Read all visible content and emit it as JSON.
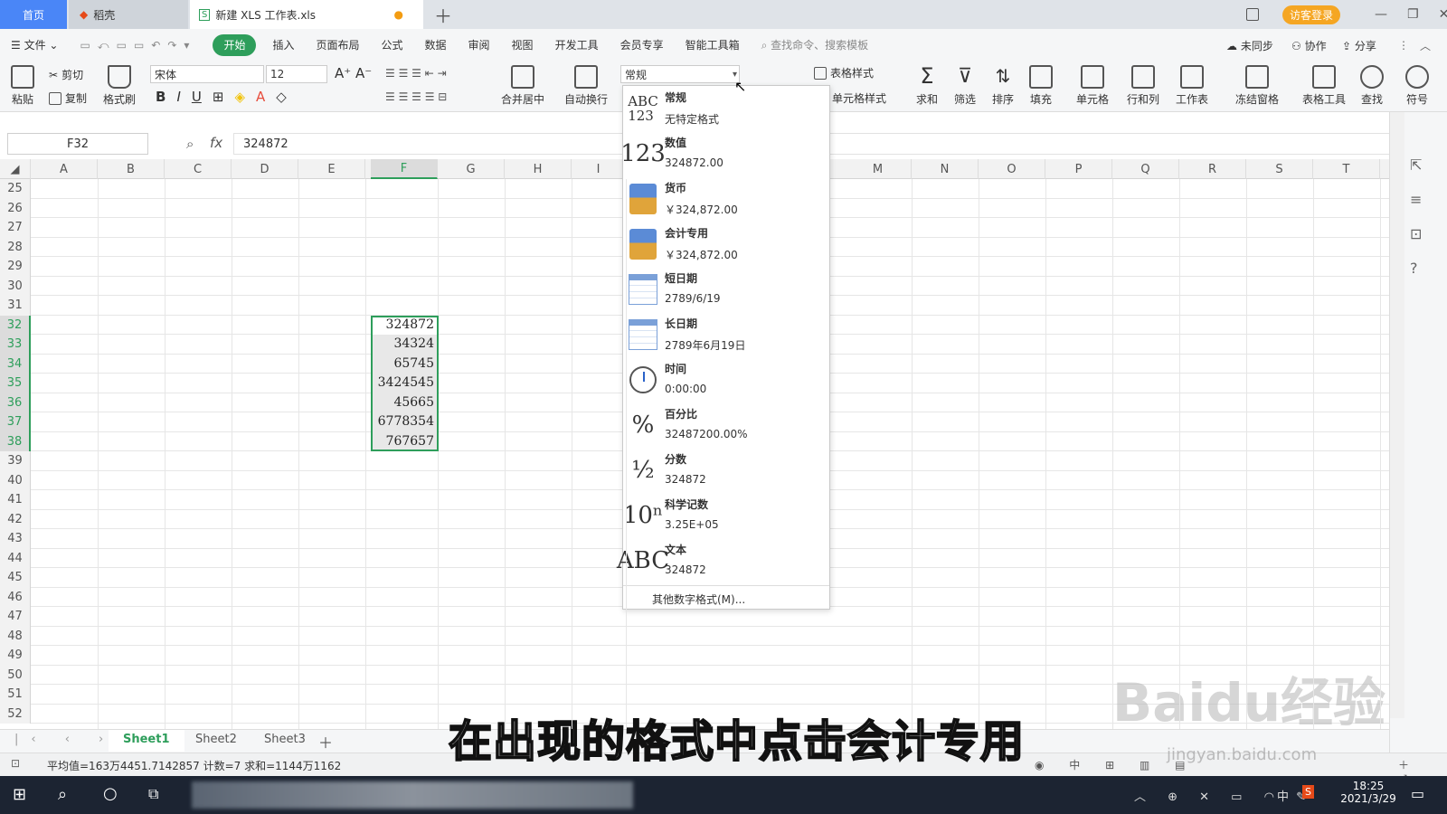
{
  "titlebar": {
    "home": "首页",
    "daoke": "稻壳",
    "doc": "新建 XLS 工作表.xls",
    "login": "访客登录"
  },
  "menu": {
    "file": "文件",
    "items": [
      "开始",
      "插入",
      "页面布局",
      "公式",
      "数据",
      "审阅",
      "视图",
      "开发工具",
      "会员专享",
      "智能工具箱"
    ],
    "search": "查找命令、搜索模板",
    "unsync": "未同步",
    "collab": "协作",
    "share": "分享"
  },
  "ribbon": {
    "paste": "粘贴",
    "cut": "剪切",
    "copy": "复制",
    "format_painter": "格式刷",
    "font": "宋体",
    "size": "12",
    "merge": "合并居中",
    "wrap": "自动换行",
    "numfmt": "常规",
    "table_style": "表格样式",
    "cell_style": "单元格样式",
    "sum": "求和",
    "filter": "筛选",
    "sort": "排序",
    "fill": "填充",
    "cell": "单元格",
    "rowcol": "行和列",
    "sheet": "工作表",
    "freeze": "冻结窗格",
    "tabletools": "表格工具",
    "find": "查找",
    "symbol": "符号"
  },
  "formula": {
    "namebox": "F32",
    "fx": "fx",
    "value": "324872"
  },
  "columns": [
    "A",
    "B",
    "C",
    "D",
    "E",
    "F",
    "G",
    "H",
    "I",
    "M",
    "N",
    "O",
    "P",
    "Q",
    "R",
    "S",
    "T"
  ],
  "rows": [
    "25",
    "26",
    "27",
    "28",
    "29",
    "30",
    "31",
    "32",
    "33",
    "34",
    "35",
    "36",
    "37",
    "38",
    "39",
    "40",
    "41",
    "42",
    "43",
    "44",
    "45",
    "46",
    "47",
    "48",
    "49",
    "50",
    "51",
    "52"
  ],
  "cells_F": [
    "324872",
    "34324",
    "65745",
    "3424545",
    "45665",
    "6778354",
    "767657"
  ],
  "dropdown": {
    "items": [
      {
        "icon": "ABC\n123",
        "name": "常规",
        "example": "无特定格式"
      },
      {
        "icon": "123",
        "name": "数值",
        "example": "324872.00"
      },
      {
        "icon": "coins",
        "name": "货币",
        "example": "￥324,872.00"
      },
      {
        "icon": "coins",
        "name": "会计专用",
        "example": "￥324,872.00"
      },
      {
        "icon": "cal",
        "name": "短日期",
        "example": "2789/6/19"
      },
      {
        "icon": "cal",
        "name": "长日期",
        "example": "2789年6月19日"
      },
      {
        "icon": "clock",
        "name": "时间",
        "example": "0:00:00"
      },
      {
        "icon": "%",
        "name": "百分比",
        "example": "32487200.00%"
      },
      {
        "icon": "½",
        "name": "分数",
        "example": "324872"
      },
      {
        "icon": "10ⁿ",
        "name": "科学记数",
        "example": "3.25E+05"
      },
      {
        "icon": "ABC",
        "name": "文本",
        "example": "324872"
      }
    ],
    "more": "其他数字格式(M)..."
  },
  "sheets": [
    "Sheet1",
    "Sheet2",
    "Sheet3"
  ],
  "status": {
    "text": "平均值=163万4451.7142857  计数=7  求和=1144万1162"
  },
  "taskbar": {
    "time": "18:25",
    "date": "2021/3/29",
    "ime": "中"
  },
  "subtitle": "在出现的格式中点击会计专用",
  "watermark": "Baidu经验",
  "watermark_url": "jingyan.baidu.com"
}
